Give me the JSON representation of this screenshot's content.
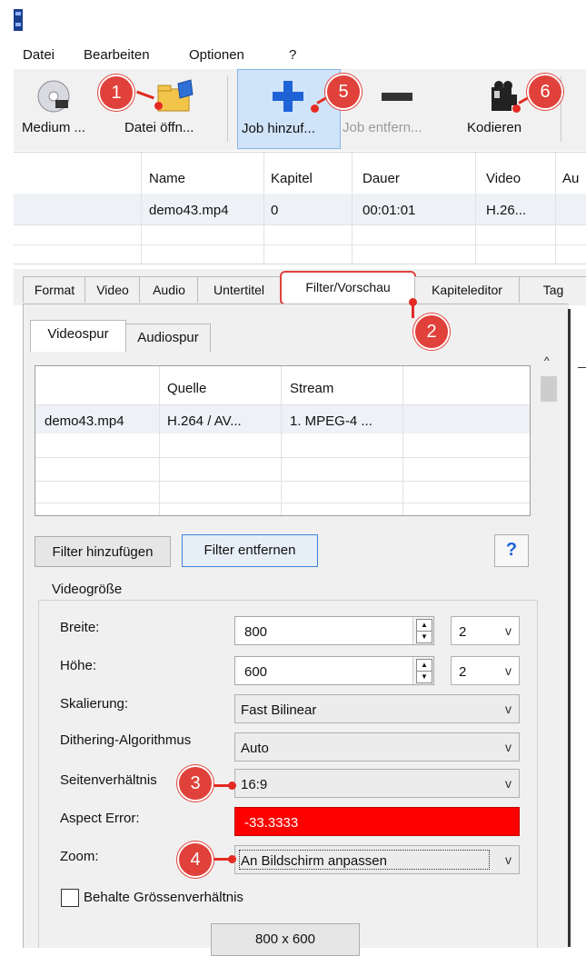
{
  "menu": [
    "Datei",
    "Bearbeiten",
    "Optionen",
    "?"
  ],
  "toolbar": {
    "medium": "Medium ...",
    "open_file": "Datei öffn...",
    "add_job": "Job hinzuf...",
    "remove_job": "Job entfern...",
    "encode": "Kodieren"
  },
  "job_table": {
    "columns": [
      "Name",
      "Kapitel",
      "Dauer",
      "Video",
      "Au"
    ],
    "rows": [
      [
        "demo43.mp4",
        "0",
        "00:01:01",
        "H.26..."
      ]
    ]
  },
  "tabs": [
    "Format",
    "Video",
    "Audio",
    "Untertitel",
    "Filter/Vorschau",
    "Kapiteleditor",
    "Tag"
  ],
  "subtabs": [
    "Videospur",
    "Audiospur"
  ],
  "track_table": {
    "columns": [
      "Quelle",
      "Stream"
    ],
    "rows": [
      [
        "demo43.mp4",
        "H.264 / AV...",
        "1. MPEG-4 ..."
      ]
    ]
  },
  "buttons": {
    "add_filter": "Filter hinzufügen",
    "remove_filter": "Filter entfernen",
    "help": "?"
  },
  "video_size": {
    "group_title": "Videogröße",
    "width_label": "Breite:",
    "width_value": "800",
    "width_step": "2",
    "height_label": "Höhe:",
    "height_value": "600",
    "height_step": "2",
    "scaling_label": "Skalierung:",
    "scaling_value": "Fast Bilinear",
    "dither_label": "Dithering-Algorithmus",
    "dither_value": "Auto",
    "aspect_label": "Seitenverhältnis",
    "aspect_value": "16:9",
    "aspect_error_label": "Aspect Error:",
    "aspect_error_value": "-33.3333",
    "zoom_label": "Zoom:",
    "zoom_value": "An Bildschirm anpassen",
    "keep_ratio_label": "Behalte Grössenverhältnis",
    "size_display": "800 x 600"
  },
  "markers": [
    "1",
    "2",
    "3",
    "4",
    "5",
    "6"
  ],
  "colors": {
    "marker": "#e0413a",
    "error_bg": "#ff0000",
    "accent_blue": "#1e63d6"
  }
}
